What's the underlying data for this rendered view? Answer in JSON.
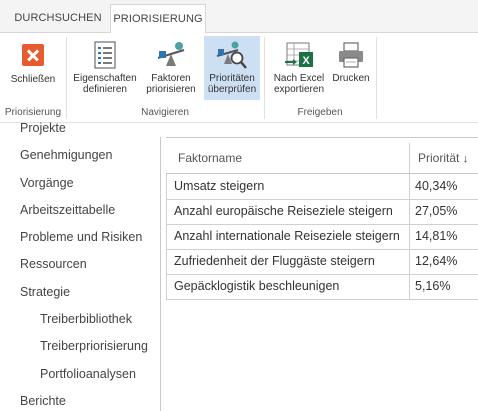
{
  "tabs": [
    {
      "label": "DURCHSUCHEN",
      "active": false
    },
    {
      "label": "PRIORISIERUNG",
      "active": true
    }
  ],
  "ribbon": {
    "groups": [
      {
        "label": "Priorisierung"
      },
      {
        "label": "Navigieren"
      },
      {
        "label": "Freigeben"
      }
    ],
    "buttons": {
      "close": {
        "line1": "Schließen",
        "icon": "close-icon"
      },
      "properties": {
        "line1": "Eigenschaften",
        "line2": "definieren",
        "icon": "properties-icon"
      },
      "prioritize_factors": {
        "line1": "Faktoren",
        "line2": "priorisieren",
        "icon": "prioritize-factors-icon"
      },
      "review_priorities": {
        "line1": "Prioritäten",
        "line2": "überprüfen",
        "icon": "review-priorities-icon",
        "selected": true
      },
      "export_excel": {
        "line1": "Nach Excel",
        "line2": "exportieren",
        "icon": "excel-icon"
      },
      "print": {
        "line1": "Drucken",
        "icon": "printer-icon"
      }
    }
  },
  "nav": {
    "items": [
      {
        "label": "Projekte"
      },
      {
        "label": "Genehmigungen"
      },
      {
        "label": "Vorgänge"
      },
      {
        "label": "Arbeitszeittabelle"
      },
      {
        "label": "Probleme und Risiken"
      },
      {
        "label": "Ressourcen"
      },
      {
        "label": "Strategie"
      },
      {
        "label": "Treiberbibliothek"
      },
      {
        "label": "Treiberpriorisierung"
      },
      {
        "label": "Portfolioanalysen"
      },
      {
        "label": "Berichte"
      }
    ]
  },
  "table": {
    "headers": {
      "name": "Faktorname",
      "priority": "Priorität",
      "sort_arrow": "↓"
    },
    "rows": [
      {
        "name": "Umsatz steigern",
        "priority": "40,34%"
      },
      {
        "name": "Anzahl europäische Reiseziele steigern",
        "priority": "27,05%"
      },
      {
        "name": "Anzahl internationale Reiseziele steigern",
        "priority": "14,81%"
      },
      {
        "name": "Zufriedenheit der Fluggäste steigern",
        "priority": "12,64%"
      },
      {
        "name": "Gepäcklogistik beschleunigen",
        "priority": "5,16%"
      }
    ]
  },
  "colors": {
    "accent_selected": "#cde0f3",
    "close_icon": "#e65c2e",
    "excel_green": "#1e7145"
  }
}
